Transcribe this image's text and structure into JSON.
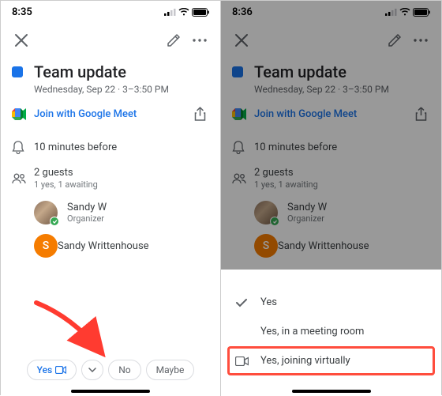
{
  "left": {
    "status_time": "8:35",
    "event": {
      "title": "Team update",
      "datetime": "Wednesday, Sep 22 · 3–3:50 PM"
    },
    "meet_label": "Join with Google Meet",
    "reminder": "10 minutes before",
    "guests": {
      "count_label": "2 guests",
      "status_label": "1 yes, 1 awaiting",
      "items": [
        {
          "name": "Sandy W",
          "role": "Organizer",
          "initial": "",
          "color": "",
          "checked": true,
          "photo": true
        },
        {
          "name": "Sandy Writtenhouse",
          "role": "",
          "initial": "S",
          "color": "#f57c00",
          "checked": false,
          "photo": false
        }
      ]
    },
    "rsvp": {
      "yes": "Yes",
      "no": "No",
      "maybe": "Maybe"
    }
  },
  "right": {
    "status_time": "8:36",
    "sheet": {
      "options": [
        {
          "label": "Yes",
          "icon": "check"
        },
        {
          "label": "Yes, in a meeting room",
          "icon": ""
        },
        {
          "label": "Yes, joining virtually",
          "icon": "video"
        }
      ]
    }
  }
}
